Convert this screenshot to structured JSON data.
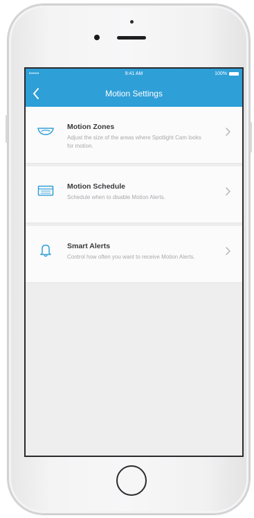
{
  "status_bar": {
    "signal": "•••••",
    "time": "9:41 AM",
    "battery": "100%"
  },
  "nav": {
    "title": "Motion Settings",
    "back_icon": "chevron-left-icon"
  },
  "settings": [
    {
      "icon": "motion-zone-icon",
      "title": "Motion Zones",
      "description": "Adjust the size of the areas where Spotlight Cam looks for motion."
    },
    {
      "icon": "calendar-icon",
      "title": "Motion Schedule",
      "description": "Schedule when to disable Motion Alerts."
    },
    {
      "icon": "bell-icon",
      "title": "Smart Alerts",
      "description": "Control how often you want to receive Motion Alerts."
    }
  ],
  "colors": {
    "accent": "#2f9fd8",
    "background": "#eeeeef"
  }
}
